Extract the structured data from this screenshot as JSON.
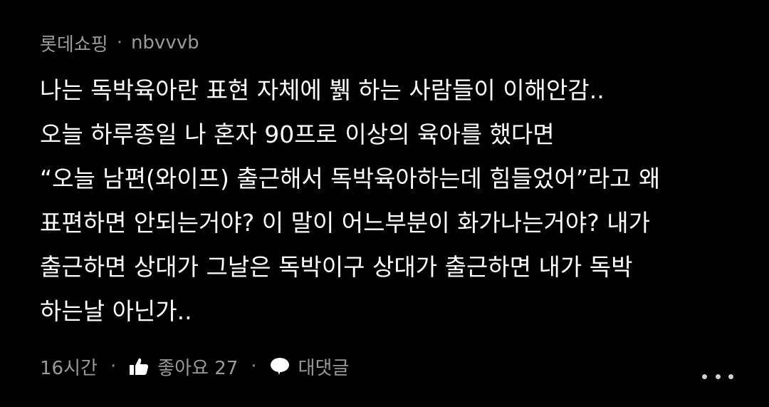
{
  "comment": {
    "channel": "롯데쇼핑",
    "separator": "·",
    "author": "nbvvvb",
    "lines": [
      "나는 독박육아란 표현 자체에 뷁 하는 사람들이 이해안감..",
      "오늘 하루종일 나 혼자 90프로 이상의 육아를 했다면",
      "“오늘 남편(와이프) 출근해서 독박육아하는데 힘들었어”라고 왜",
      "표편하면 안되는거야? 이 말이 어느부분이 화가나는거야? 내가",
      "출근하면 상대가 그날은 독박이구 상대가 출근하면 내가 독박",
      "하는날 아닌가.."
    ],
    "time": "16시간",
    "like_label": "좋아요 27",
    "reply_label": "대댓글"
  },
  "icons": {
    "like": "thumbs-up-icon",
    "reply": "speech-bubble-icon",
    "more": "more-dots-icon"
  },
  "colors": {
    "background": "#000000",
    "text": "#ffffff",
    "muted": "#9a9a9a"
  }
}
